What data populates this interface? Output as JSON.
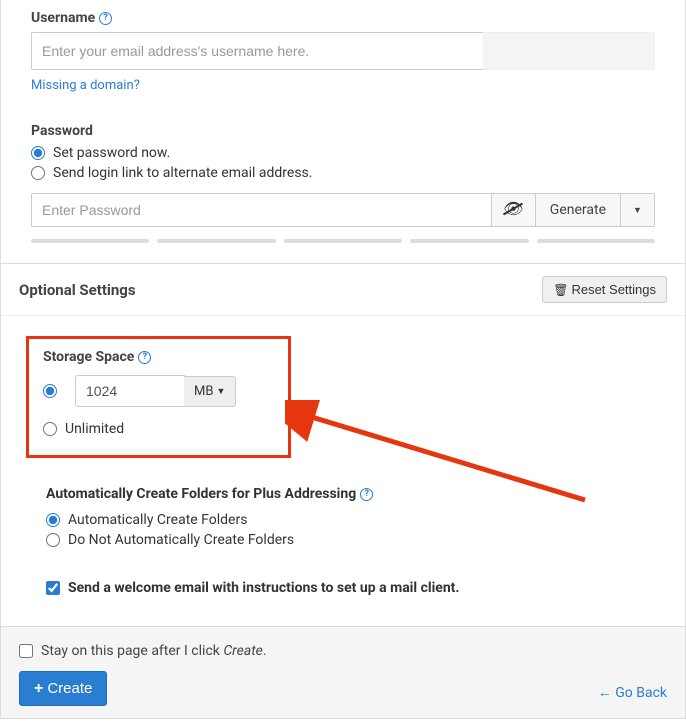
{
  "username": {
    "label": "Username",
    "placeholder": "Enter your email address's username here.",
    "missing_link": "Missing a domain?"
  },
  "password": {
    "label": "Password",
    "option_now": "Set password now.",
    "option_link": "Send login link to alternate email address.",
    "placeholder": "Enter Password",
    "generate": "Generate"
  },
  "optional": {
    "heading": "Optional Settings",
    "reset": "Reset Settings"
  },
  "storage": {
    "label": "Storage Space",
    "value": "1024",
    "unit": "MB",
    "unlimited": "Unlimited"
  },
  "plus": {
    "label": "Automatically Create Folders for Plus Addressing",
    "auto": "Automatically Create Folders",
    "no_auto": "Do Not Automatically Create Folders"
  },
  "welcome": {
    "label": "Send a welcome email with instructions to set up a mail client."
  },
  "footer": {
    "stay_prefix": "Stay on this page after I click ",
    "stay_em": "Create",
    "stay_suffix": ".",
    "create": "Create",
    "goback": "Go Back"
  }
}
